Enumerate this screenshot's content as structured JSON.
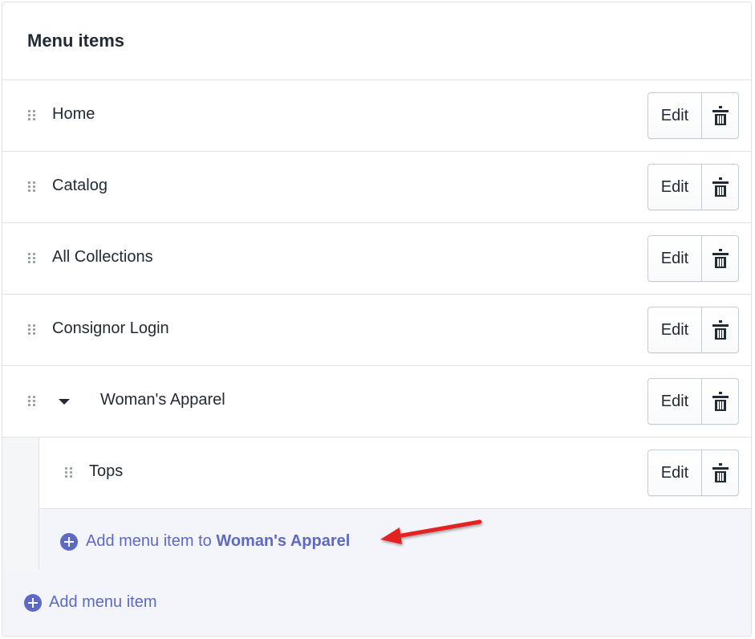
{
  "header": {
    "title": "Menu items"
  },
  "items": [
    {
      "label": "Home"
    },
    {
      "label": "Catalog"
    },
    {
      "label": "All Collections"
    },
    {
      "label": "Consignor Login"
    },
    {
      "label": "Woman's Apparel"
    }
  ],
  "child_items": [
    {
      "label": "Tops"
    }
  ],
  "actions": {
    "edit_label": "Edit",
    "delete_icon": "trash-icon"
  },
  "add_sub": {
    "prefix": "Add menu item to ",
    "parent": "Woman's Apparel"
  },
  "add_root": {
    "label": "Add menu item"
  },
  "colors": {
    "accent": "#5c6ac4",
    "annotation_arrow": "#e32120",
    "border": "#dfe3e8"
  }
}
